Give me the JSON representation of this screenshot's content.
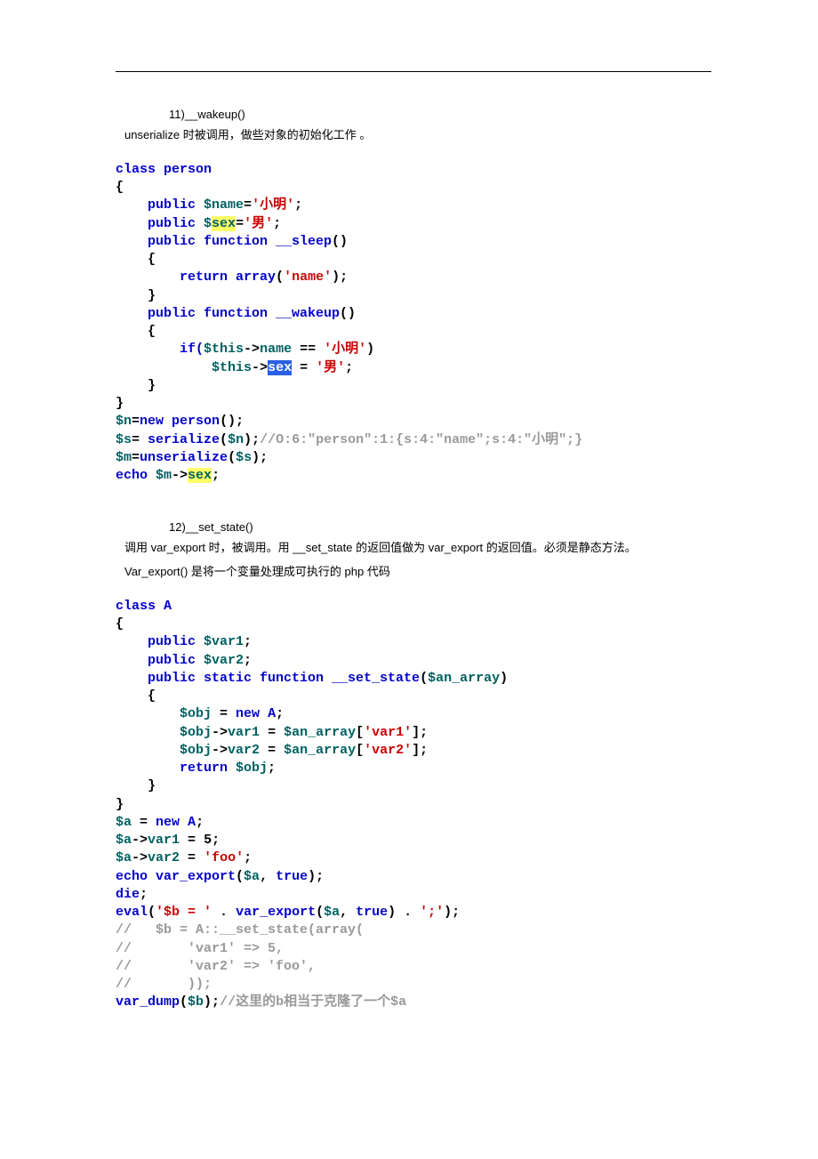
{
  "section1": {
    "heading": "11)__wakeup()",
    "desc_parts": [
      "unserialize",
      "   时被调用，做些对象的初始化工作",
      "   。"
    ]
  },
  "code1": {
    "l1_a": "class ",
    "l1_b": "person",
    "l2": "{",
    "l3_a": "    public ",
    "l3_b": "$name",
    "l3_c": "=",
    "l3_d": "'小明'",
    "l3_e": ";",
    "l4_a": "    public ",
    "l4_b": "$",
    "l4_c": "sex",
    "l4_d": "=",
    "l4_e": "'男'",
    "l4_f": ";",
    "l5_a": "    public function ",
    "l5_b": "__sleep",
    "l5_c": "()",
    "l6": "    {",
    "l7_a": "        return ",
    "l7_b": "array",
    "l7_c": "(",
    "l7_d": "'name'",
    "l7_e": ");",
    "l8": "    }",
    "l9_a": "    public function ",
    "l9_b": "__wakeup",
    "l9_c": "()",
    "l10": "    {",
    "l11_a": "        if(",
    "l11_b": "$this",
    "l11_c": "->",
    "l11_d": "name",
    "l11_e": " == ",
    "l11_f": "'小明'",
    "l11_g": ")",
    "l12_a": "            ",
    "l12_b": "$this",
    "l12_c": "->",
    "l12_d": "sex",
    "l12_e": " = ",
    "l12_f": "'男'",
    "l12_g": ";",
    "l13": "    }",
    "l14": "}",
    "l15_a": "$n",
    "l15_b": "=",
    "l15_c": "new ",
    "l15_d": "person",
    "l15_e": "();",
    "l16_a": "$s",
    "l16_b": "= ",
    "l16_c": "serialize",
    "l16_d": "(",
    "l16_e": "$n",
    "l16_f": ");",
    "l16_g": "//O:6:\"person\":1:{s:4:\"name\";s:4:\"小明\";}",
    "l17_a": "$m",
    "l17_b": "=",
    "l17_c": "unserialize",
    "l17_d": "(",
    "l17_e": "$s",
    "l17_f": ");",
    "l18_a": "echo ",
    "l18_b": "$m",
    "l18_c": "->",
    "l18_d": "sex",
    "l18_e": ";"
  },
  "section2": {
    "heading": "12)__set_state()",
    "desc1_parts": [
      "调用 var_export",
      "   时，被调用。用",
      "   __set_state",
      "   的返回值做为",
      "   var_export",
      "   的返回值。必须是静态方法。"
    ],
    "desc2_parts": [
      "Var_export()",
      "   是将一个变量处理成可执行的",
      "   php  代码"
    ]
  },
  "code2": {
    "l1_a": "class ",
    "l1_b": "A",
    "l2": "{",
    "l3_a": "    public ",
    "l3_b": "$var1",
    "l3_c": ";",
    "l4_a": "    public ",
    "l4_b": "$var2",
    "l4_c": ";",
    "l5_a": "    public static function ",
    "l5_b": "__set_state",
    "l5_c": "(",
    "l5_d": "$an_array",
    "l5_e": ")",
    "l6": "    {",
    "l7_a": "        ",
    "l7_b": "$obj",
    "l7_c": " = ",
    "l7_d": "new ",
    "l7_e": "A",
    "l7_f": ";",
    "l8_a": "        ",
    "l8_b": "$obj",
    "l8_c": "->",
    "l8_d": "var1",
    "l8_e": " = ",
    "l8_f": "$an_array",
    "l8_g": "[",
    "l8_h": "'var1'",
    "l8_i": "];",
    "l9_a": "        ",
    "l9_b": "$obj",
    "l9_c": "->",
    "l9_d": "var2",
    "l9_e": " = ",
    "l9_f": "$an_array",
    "l9_g": "[",
    "l9_h": "'var2'",
    "l9_i": "];",
    "l10_a": "        return ",
    "l10_b": "$obj",
    "l10_c": ";",
    "l11": "    }",
    "l12": "}",
    "l13_a": "$a",
    "l13_b": " = ",
    "l13_c": "new ",
    "l13_d": "A",
    "l13_e": ";",
    "l14_a": "$a",
    "l14_b": "->",
    "l14_c": "var1",
    "l14_d": " = ",
    "l14_e": "5",
    "l14_f": ";",
    "l15_a": "$a",
    "l15_b": "->",
    "l15_c": "var2",
    "l15_d": " = ",
    "l15_e": "'foo'",
    "l15_f": ";",
    "l16_a": "echo ",
    "l16_b": "var_export",
    "l16_c": "(",
    "l16_d": "$a",
    "l16_e": ", ",
    "l16_f": "true",
    "l16_g": ");",
    "l17_a": "die",
    "l17_b": ";",
    "l18_a": "eval",
    "l18_b": "(",
    "l18_c": "'$b = '",
    "l18_d": " . ",
    "l18_e": "var_export",
    "l18_f": "(",
    "l18_g": "$a",
    "l18_h": ", ",
    "l18_i": "true",
    "l18_j": ") . ",
    "l18_k": "';'",
    "l18_l": ");",
    "l19": "//   $b = A::__set_state(array(",
    "l20": "//       'var1' => 5,",
    "l21": "//       'var2' => 'foo',",
    "l22": "//       ));",
    "l23_a": "var_dump",
    "l23_b": "(",
    "l23_c": "$b",
    "l23_d": ");",
    "l23_e": "//",
    "l23_f": "这里的b相当于克隆了一个$a"
  }
}
